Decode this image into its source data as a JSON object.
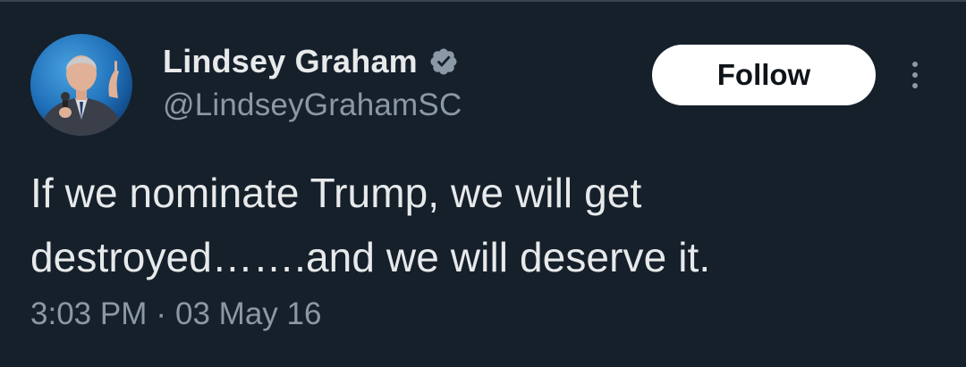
{
  "author": {
    "display_name": "Lindsey Graham",
    "handle": "@LindseyGrahamSC",
    "verified": true
  },
  "actions": {
    "follow_label": "Follow",
    "more_icon": "more-vertical-icon"
  },
  "tweet": {
    "text": "If we nominate Trump, we will get\ndestroyed…….and we will deserve it.",
    "time": "3:03 PM",
    "separator": "·",
    "date": "03 May 16"
  },
  "colors": {
    "background": "#15202b",
    "primary_text": "#e7e9ea",
    "secondary_text": "#8b98a5",
    "follow_bg": "#ffffff",
    "verified_badge": "#8b98a5"
  }
}
